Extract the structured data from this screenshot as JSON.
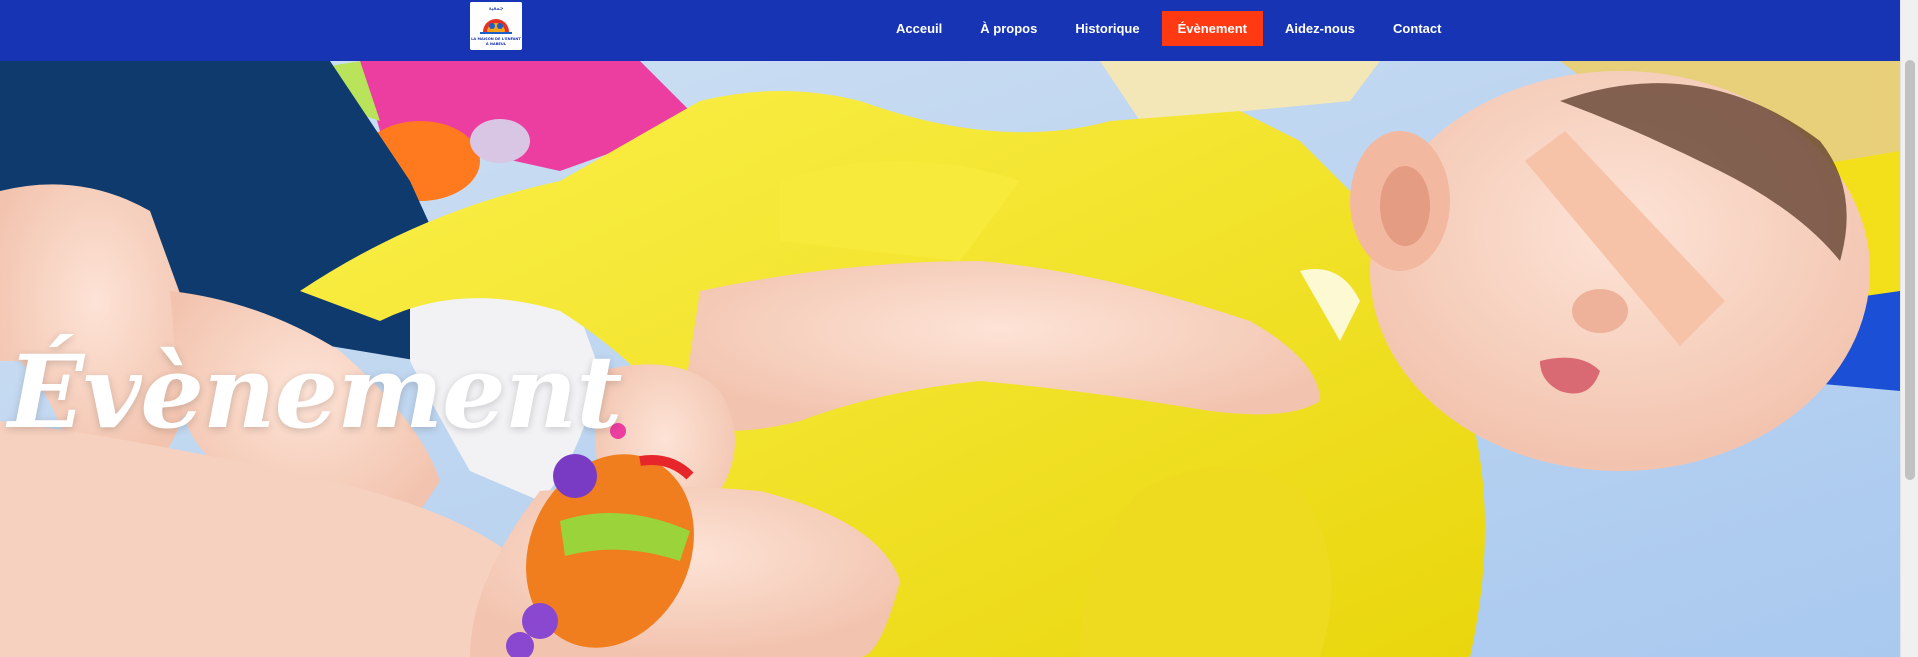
{
  "brand": {
    "logo_text_line1": "LA MAISON DE L'ENFANT",
    "logo_text_line2": "À NABEUL",
    "logo_arabic": "جمعية"
  },
  "nav": {
    "items": [
      {
        "label": "Acceuil",
        "active": false
      },
      {
        "label": "À propos",
        "active": false
      },
      {
        "label": "Historique",
        "active": false
      },
      {
        "label": "Évènement",
        "active": true
      },
      {
        "label": "Aidez-nous",
        "active": false
      },
      {
        "label": "Contact",
        "active": false
      }
    ]
  },
  "hero": {
    "title": "Évènement"
  },
  "colors": {
    "nav_bg": "#1634b4",
    "nav_active": "#ff3a12",
    "hero_accent": "#f5e414"
  }
}
